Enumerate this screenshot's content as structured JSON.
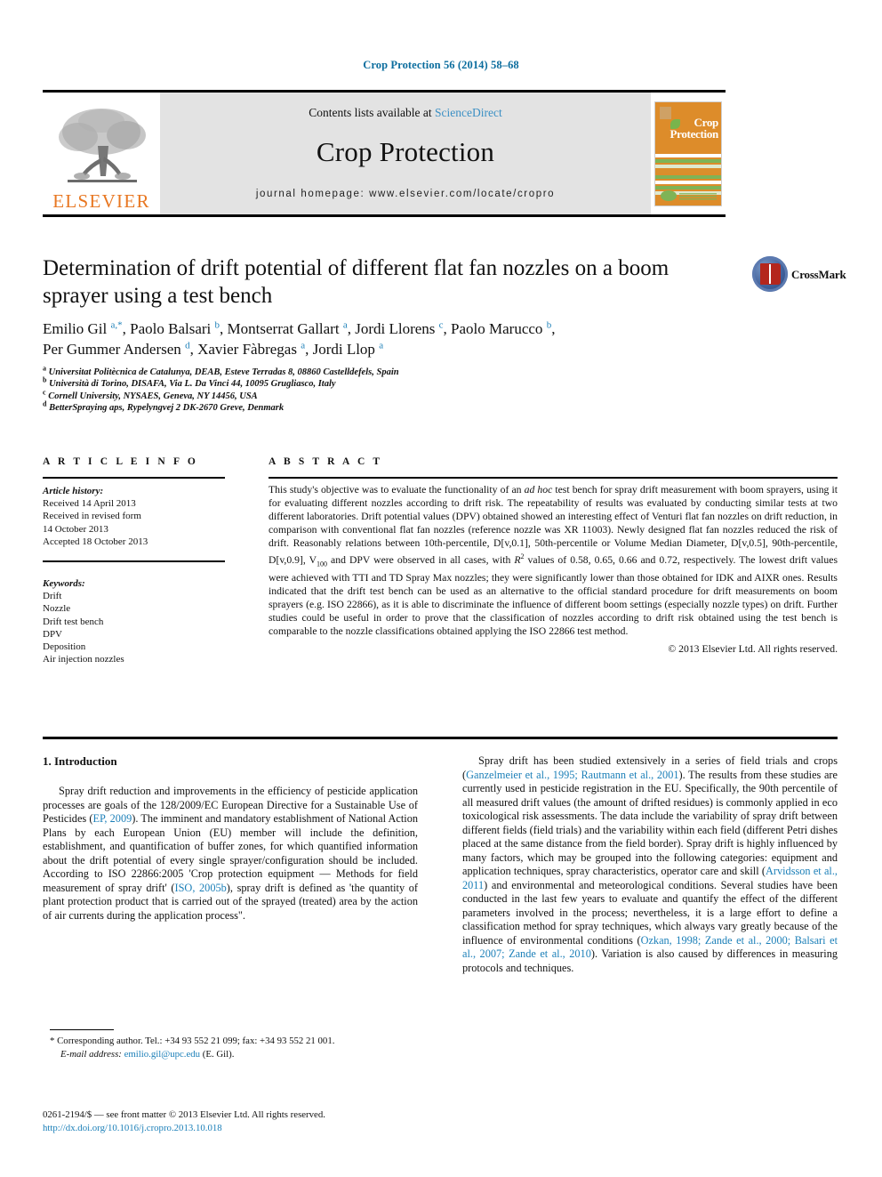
{
  "running_head": "Crop Protection 56 (2014) 58–68",
  "masthead": {
    "contents_prefix": "Contents lists available at ",
    "sciencedirect": "ScienceDirect",
    "journal_title": "Crop Protection",
    "homepage": "journal homepage: www.elsevier.com/locate/cropro",
    "publisher_wordmark": "ELSEVIER",
    "cover_title_line1": "Crop",
    "cover_title_line2": "Protection"
  },
  "article": {
    "title": "Determination of drift potential of different flat fan nozzles on a boom sprayer using a test bench",
    "crossmark_label": "CrossMark",
    "authors_line1": "Emilio Gil <sup>a,*</sup>, Paolo Balsari <sup>b</sup>, Montserrat Gallart <sup>a</sup>, Jordi Llorens <sup>c</sup>, Paolo Marucco <sup>b</sup>,",
    "authors_line2": "Per Gummer Andersen <sup>d</sup>, Xavier Fàbregas <sup>a</sup>, Jordi Llop <sup>a</sup>",
    "affiliations": [
      "<sup>a</sup> Universitat Politècnica de Catalunya, DEAB, Esteve Terradas 8, 08860 Castelldefels, Spain",
      "<sup>b</sup> Università di Torino, DISAFA, Via L. Da Vinci 44, 10095 Grugliasco, Italy",
      "<sup>c</sup> Cornell University, NYSAES, Geneva, NY 14456, USA",
      "<sup>d</sup> BetterSpraying aps, Rypelyngvej 2 DK-2670 Greve, Denmark"
    ]
  },
  "article_info": {
    "heading": "A R T I C L E   I N F O",
    "history_label": "Article history:",
    "history": [
      "Received 14 April 2013",
      "Received in revised form",
      "14 October 2013",
      "Accepted 18 October 2013"
    ],
    "keywords_label": "Keywords:",
    "keywords": [
      "Drift",
      "Nozzle",
      "Drift test bench",
      "DPV",
      "Deposition",
      "Air injection nozzles"
    ]
  },
  "abstract": {
    "heading": "A B S T R A C T",
    "body": "This study's objective was to evaluate the functionality of an <i>ad hoc</i> test bench for spray drift measurement with boom sprayers, using it for evaluating different nozzles according to drift risk. The repeatability of results was evaluated by conducting similar tests at two different laboratories. Drift potential values (DPV) obtained showed an interesting effect of Venturi flat fan nozzles on drift reduction, in comparison with conventional flat fan nozzles (reference nozzle was XR 11003). Newly designed flat fan nozzles reduced the risk of drift. Reasonably relations between 10th-percentile, D[v,0.1], 50th-percentile or Volume Median Diameter, D[v,0.5], 90th-percentile, D[v,0.9], V<sub>100</sub> and DPV were observed in all cases, with <i>R</i><sup>2</sup> values of 0.58, 0.65, 0.66 and 0.72, respectively. The lowest drift values were achieved with TTI and TD Spray Max nozzles; they were significantly lower than those obtained for IDK and AIXR ones. Results indicated that the drift test bench can be used as an alternative to the official standard procedure for drift measurements on boom sprayers (e.g. ISO 22866), as it is able to discriminate the influence of different boom settings (especially nozzle types) on drift. Further studies could be useful in order to prove that the classification of nozzles according to drift risk obtained using the test bench is comparable to the nozzle classifications obtained applying the ISO 22866 test method.",
    "copyright": "© 2013 Elsevier Ltd. All rights reserved."
  },
  "body": {
    "section_heading": "1. Introduction",
    "left_paragraph": "Spray drift reduction and improvements in the efficiency of pesticide application processes are goals of the 128/2009/EC European Directive for a Sustainable Use of Pesticides (<span class=\"ref\">EP, 2009</span>). The imminent and mandatory establishment of National Action Plans by each European Union (EU) member will include the definition, establishment, and quantification of buffer zones, for which quantified information about the drift potential of every single sprayer/configuration should be included. According to ISO 22866:2005 'Crop protection equipment &mdash; Methods for field measurement of spray drift' (<span class=\"ref\">ISO, 2005b</span>), spray drift is defined as 'the quantity of plant protection product that is carried out of the sprayed (treated) area by the action of air currents during the application process\".",
    "right_paragraph": "Spray drift has been studied extensively in a series of field trials and crops (<span class=\"ref\">Ganzelmeier et al., 1995; Rautmann et al., 2001</span>). The results from these studies are currently used in pesticide registration in the EU. Specifically, the 90th percentile of all measured drift values (the amount of drifted residues) is commonly applied in eco toxicological risk assessments. The data include the variability of spray drift between different fields (field trials) and the variability within each field (different Petri dishes placed at the same distance from the field border). Spray drift is highly influenced by many factors, which may be grouped into the following categories: equipment and application techniques, spray characteristics, operator care and skill (<span class=\"ref\">Arvidsson et al., 2011</span>) and environmental and meteorological conditions. Several studies have been conducted in the last few years to evaluate and quantify the effect of the different parameters involved in the process; nevertheless, it is a large effort to define a classification method for spray techniques, which always vary greatly because of the influence of environmental conditions (<span class=\"ref\">Ozkan, 1998; Zande et al., 2000; Balsari et al., 2007; Zande et al., 2010</span>). Variation is also caused by differences in measuring protocols and techniques."
  },
  "footer": {
    "corresponding": "* Corresponding author. Tel.: +34 93 552 21 099; fax: +34 93 552 21 001.",
    "email_label": "E-mail address:",
    "email": "emilio.gil@upc.edu",
    "email_suffix": "(E. Gil).",
    "imprint": "0261-2194/$ — see front matter © 2013 Elsevier Ltd. All rights reserved.",
    "doi": "http://dx.doi.org/10.1016/j.cropro.2013.10.018"
  },
  "colors": {
    "link": "#1b7fb8",
    "runhead": "#0b6d9e",
    "elsevier_orange": "#e87722",
    "masthead_gray": "#e3e3e3",
    "cover_orange": "#dd8c2a",
    "cover_green": "#79b44c"
  }
}
